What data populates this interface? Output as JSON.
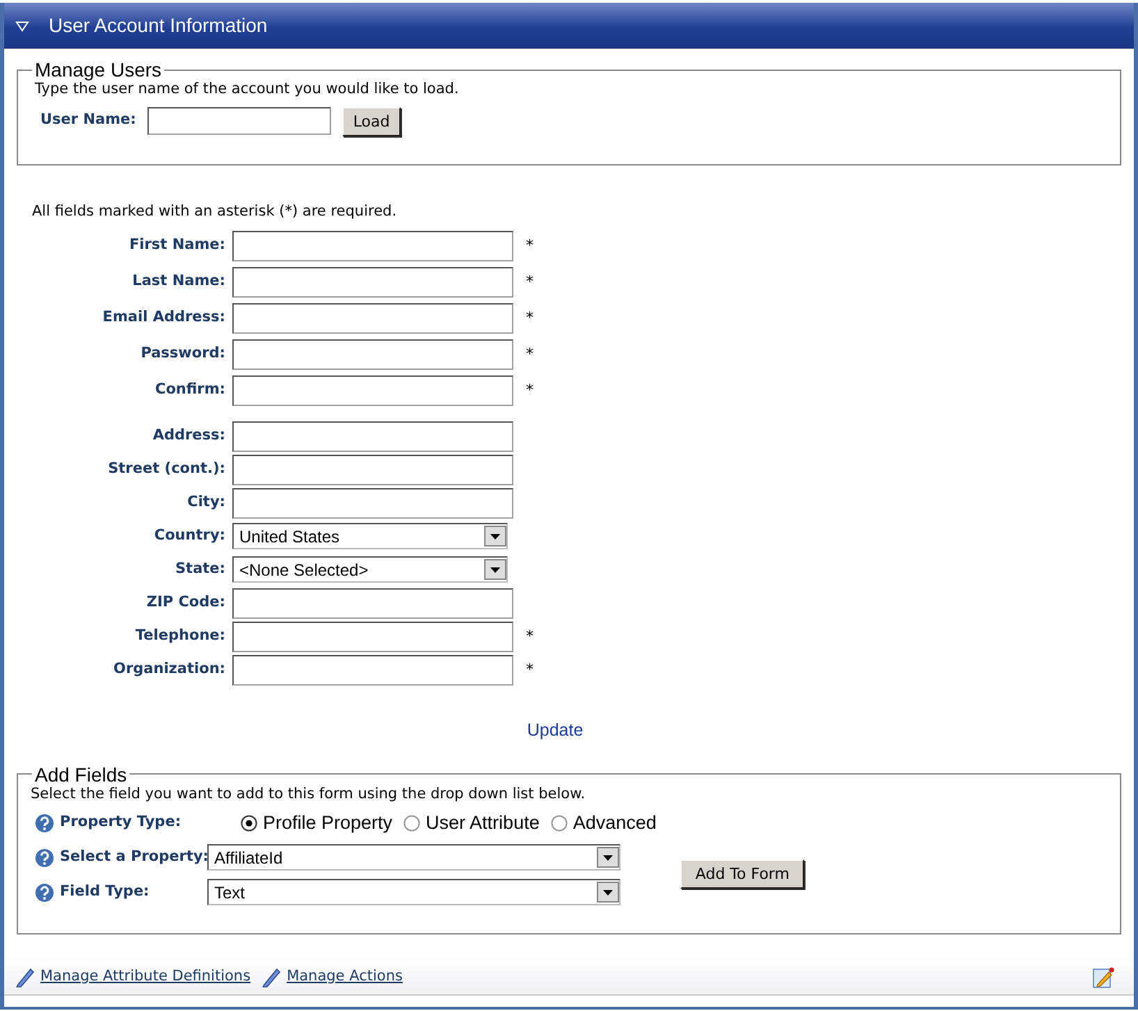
{
  "panel": {
    "title": "User Account Information"
  },
  "manage_users": {
    "legend": "Manage Users",
    "hint": "Type the user name of the account you would like to load.",
    "user_name_label": "User Name:",
    "load_button": "Load"
  },
  "required_note": "All fields marked with an asterisk (*) are required.",
  "field_groups": [
    [
      {
        "label": "First Name:",
        "kind": "text",
        "required_mark": "*"
      },
      {
        "label": "Last Name:",
        "kind": "text",
        "required_mark": "*"
      },
      {
        "label": "Email Address:",
        "kind": "text",
        "required_mark": "*"
      },
      {
        "label": "Password:",
        "kind": "text",
        "required_mark": "*"
      },
      {
        "label": "Confirm:",
        "kind": "text",
        "required_mark": "*"
      }
    ],
    [
      {
        "label": "Address:",
        "kind": "text"
      },
      {
        "label": "Street (cont.):",
        "kind": "text"
      },
      {
        "label": "City:",
        "kind": "text"
      },
      {
        "label": "Country:",
        "kind": "select",
        "value": "United States"
      },
      {
        "label": "State:",
        "kind": "select",
        "value": "<None Selected>"
      },
      {
        "label": "ZIP Code:",
        "kind": "text"
      },
      {
        "label": "Telephone:",
        "kind": "text",
        "required_mark": "*"
      },
      {
        "label": "Organization:",
        "kind": "text",
        "required_mark": "*"
      }
    ]
  ],
  "update_link": "Update",
  "add_fields": {
    "legend": "Add Fields",
    "hint": "Select the field you want to add to this form using the drop down list below.",
    "property_type_label": "Property Type:",
    "property_types": [
      {
        "label": "Profile Property",
        "selected": true
      },
      {
        "label": "User Attribute",
        "selected": false
      },
      {
        "label": "Advanced",
        "selected": false
      }
    ],
    "select_property_label": "Select a Property:",
    "select_property_value": "AffiliateId",
    "field_type_label": "Field Type:",
    "field_type_value": "Text",
    "add_button": "Add To Form"
  },
  "footer_links": [
    "Manage Attribute Definitions",
    "Manage Actions"
  ]
}
